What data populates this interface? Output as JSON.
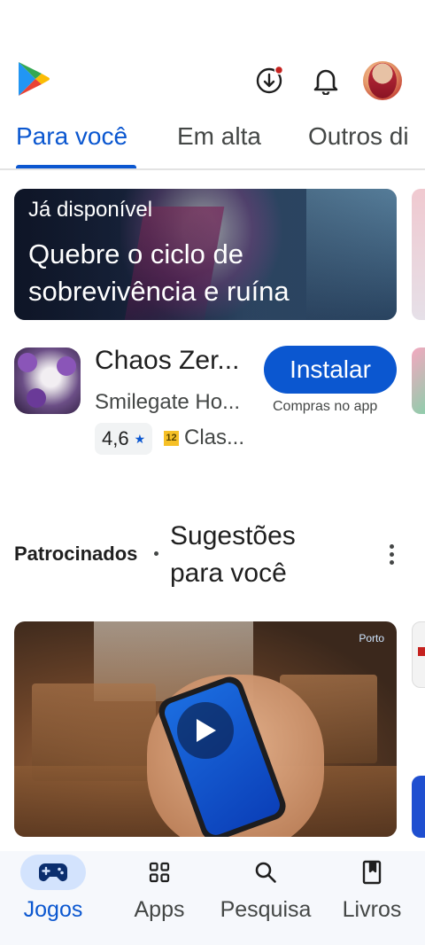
{
  "header": {
    "logo_icon": "google-play-logo",
    "download_icon": "download-arrow-icon",
    "notification_icon": "bell-icon",
    "avatar": "user-avatar",
    "accent": "#0b57d0",
    "badge_color": "#c5221f"
  },
  "tabs": [
    {
      "label": "Para você",
      "active": true
    },
    {
      "label": "Em alta",
      "active": false
    },
    {
      "label": "Outros di",
      "active": false
    }
  ],
  "banner": {
    "kicker": "Já disponível",
    "title": "Quebre o ciclo de sobrevivência e ruína"
  },
  "app": {
    "name": "Chaos Zer...",
    "developer": "Smilegate Ho...",
    "rating": "4,6",
    "classification_badge": "12",
    "classification": "Clas...",
    "install_label": "Instalar",
    "in_app_purchases": "Compras no app"
  },
  "section": {
    "sponsored_label": "Patrocinados",
    "title": "Sugestões para você",
    "video_brand": "Porto"
  },
  "bottom_nav": [
    {
      "label": "Jogos",
      "icon": "gamepad-icon",
      "active": true
    },
    {
      "label": "Apps",
      "icon": "apps-grid-icon",
      "active": false
    },
    {
      "label": "Pesquisa",
      "icon": "search-icon",
      "active": false
    },
    {
      "label": "Livros",
      "icon": "book-icon",
      "active": false
    }
  ]
}
